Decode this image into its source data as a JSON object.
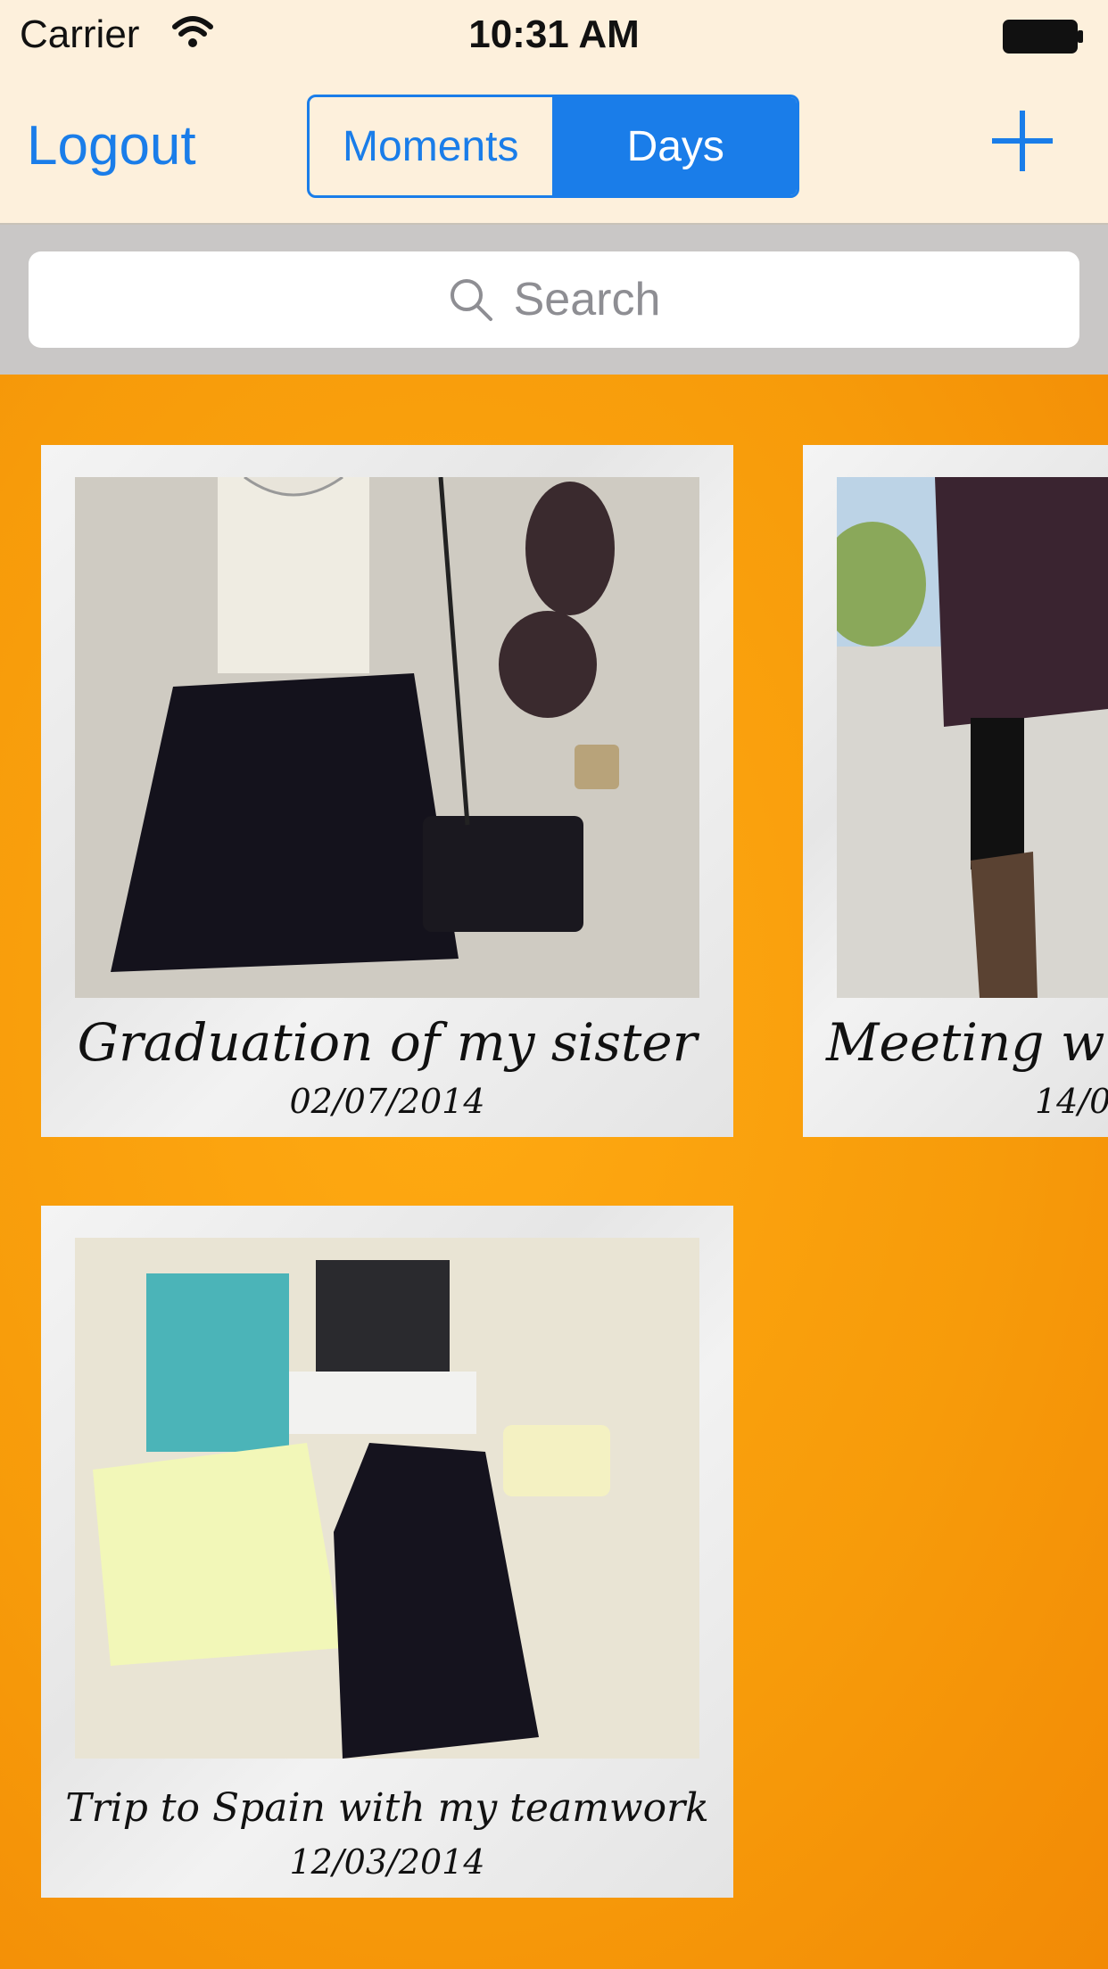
{
  "status": {
    "carrier": "Carrier",
    "time": "10:31 AM"
  },
  "nav": {
    "logout_label": "Logout",
    "segments": [
      {
        "label": "Moments",
        "selected": false
      },
      {
        "label": "Days",
        "selected": true
      }
    ],
    "add_icon": "plus-icon",
    "accent_color": "#1a7de9"
  },
  "search": {
    "placeholder": "Search",
    "value": ""
  },
  "moments": [
    {
      "title": "Graduation of my sister",
      "date": "02/07/2014"
    },
    {
      "title": "Meeting w",
      "date": "14/0"
    },
    {
      "title": "Trip to Spain with my teamwork",
      "date": "12/03/2014"
    }
  ]
}
